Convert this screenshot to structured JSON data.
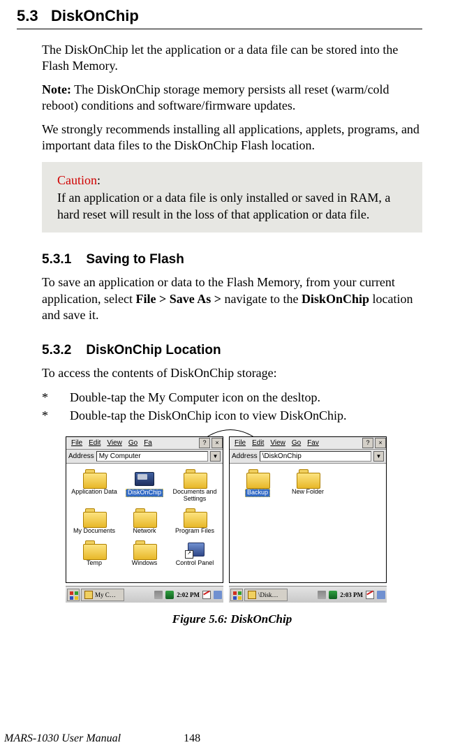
{
  "section": {
    "number": "5.3",
    "title": "DiskOnChip"
  },
  "intro": "The DiskOnChip let the application or a data file can be stored into the Flash Memory.",
  "note_label": "Note:",
  "note_text": " The DiskOnChip storage memory persists all reset (warm/cold reboot) conditions and software/firmware updates.",
  "rec_text": "We strongly recommends installing all applications, applets, programs, and important data files to the DiskOnChip Flash location.",
  "caution": {
    "label": "Caution",
    "colon": ":",
    "text": "If an application or a data file is only installed or saved in RAM, a hard reset will result in the loss of that application or data file."
  },
  "sub1": {
    "number": "5.3.1",
    "title": "Saving to Flash",
    "p1_a": "To save an application or data to the Flash Memory, from your current application, select ",
    "p1_b": "File > Save As >",
    "p1_c": " navigate to the ",
    "p1_d": "DiskOnChip",
    "p1_e": " location and save it."
  },
  "sub2": {
    "number": "5.3.2",
    "title": "DiskOnChip Location",
    "intro": "To access the contents of DiskOnChip storage:",
    "items": [
      {
        "marker": "*",
        "a": "Double-tap the ",
        "b": "My Computer",
        "c": " icon on the desltop."
      },
      {
        "marker": "*",
        "a": "Double-tap the ",
        "b": "DiskOnChip",
        "c": " icon to view ",
        "d": "DiskOnChip",
        "e": "."
      }
    ]
  },
  "win1": {
    "menu": {
      "file": "File",
      "edit": "Edit",
      "view": "View",
      "go": "Go",
      "fav": "Fa",
      "help": "?",
      "close": "×"
    },
    "address_label": "Address",
    "address_value": "My Computer",
    "icons": [
      {
        "label": "Application Data",
        "type": "folder"
      },
      {
        "label": "DiskOnChip",
        "type": "disk",
        "selected": true
      },
      {
        "label": "Documents and Settings",
        "type": "folder"
      },
      {
        "label": "My Documents",
        "type": "folder"
      },
      {
        "label": "Network",
        "type": "folder"
      },
      {
        "label": "Program Files",
        "type": "folder"
      },
      {
        "label": "Temp",
        "type": "folder"
      },
      {
        "label": "Windows",
        "type": "folder"
      },
      {
        "label": "Control Panel",
        "type": "cpanel"
      }
    ],
    "task": "My C…",
    "clock": "2:02 PM"
  },
  "win2": {
    "menu": {
      "file": "File",
      "edit": "Edit",
      "view": "View",
      "go": "Go",
      "fav": "Fav",
      "help": "?",
      "close": "×"
    },
    "address_label": "Address",
    "address_value": "\\DiskOnChip",
    "icons": [
      {
        "label": "Backup",
        "type": "folder",
        "selected": true
      },
      {
        "label": "New Folder",
        "type": "folder"
      }
    ],
    "task": "\\Disk…",
    "clock": "2:03 PM"
  },
  "figure": "Figure 5.6: DiskOnChip",
  "footer": {
    "manual": "MARS-1030 User Manual",
    "page": "148"
  }
}
